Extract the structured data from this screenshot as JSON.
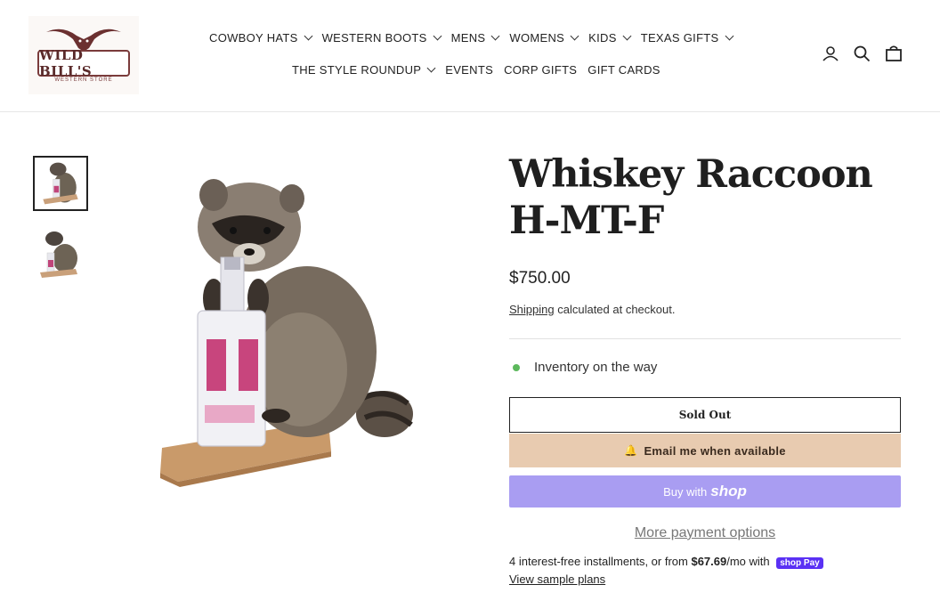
{
  "header": {
    "logo": {
      "name": "WILD BILL'S",
      "sub": "WESTERN STORE"
    },
    "nav_row1": [
      {
        "label": "COWBOY HATS",
        "dropdown": true
      },
      {
        "label": "WESTERN BOOTS",
        "dropdown": true
      },
      {
        "label": "MENS",
        "dropdown": true
      },
      {
        "label": "WOMENS",
        "dropdown": true
      },
      {
        "label": "KIDS",
        "dropdown": true
      },
      {
        "label": "TEXAS GIFTS",
        "dropdown": true
      }
    ],
    "nav_row2": [
      {
        "label": "THE STYLE ROUNDUP",
        "dropdown": true
      },
      {
        "label": "EVENTS",
        "dropdown": false
      },
      {
        "label": "CORP GIFTS",
        "dropdown": false
      },
      {
        "label": "GIFT CARDS",
        "dropdown": false
      }
    ],
    "icons": [
      "account-icon",
      "search-icon",
      "cart-icon"
    ]
  },
  "product": {
    "title": "Whiskey Raccoon H-MT-F",
    "price": "$750.00",
    "shipping_link": "Shipping",
    "shipping_rest": " calculated at checkout.",
    "inventory": "Inventory on the way",
    "sold_out": "Sold Out",
    "email_btn": "Email me when available",
    "buy_with": "Buy with",
    "buy_brand": "shop",
    "more_payment": "More payment options",
    "installments_pre": "4 interest-free installments, or from ",
    "installments_amount": "$67.69",
    "installments_post": "/mo with ",
    "installments_brand": "shop Pay",
    "view_plans": "View sample plans"
  },
  "colors": {
    "email_btn_bg": "#e8cbb0",
    "shop_btn_bg": "#a99df2",
    "inventory_dot": "#5cb85c",
    "logo_brand": "#7a3b3b"
  }
}
